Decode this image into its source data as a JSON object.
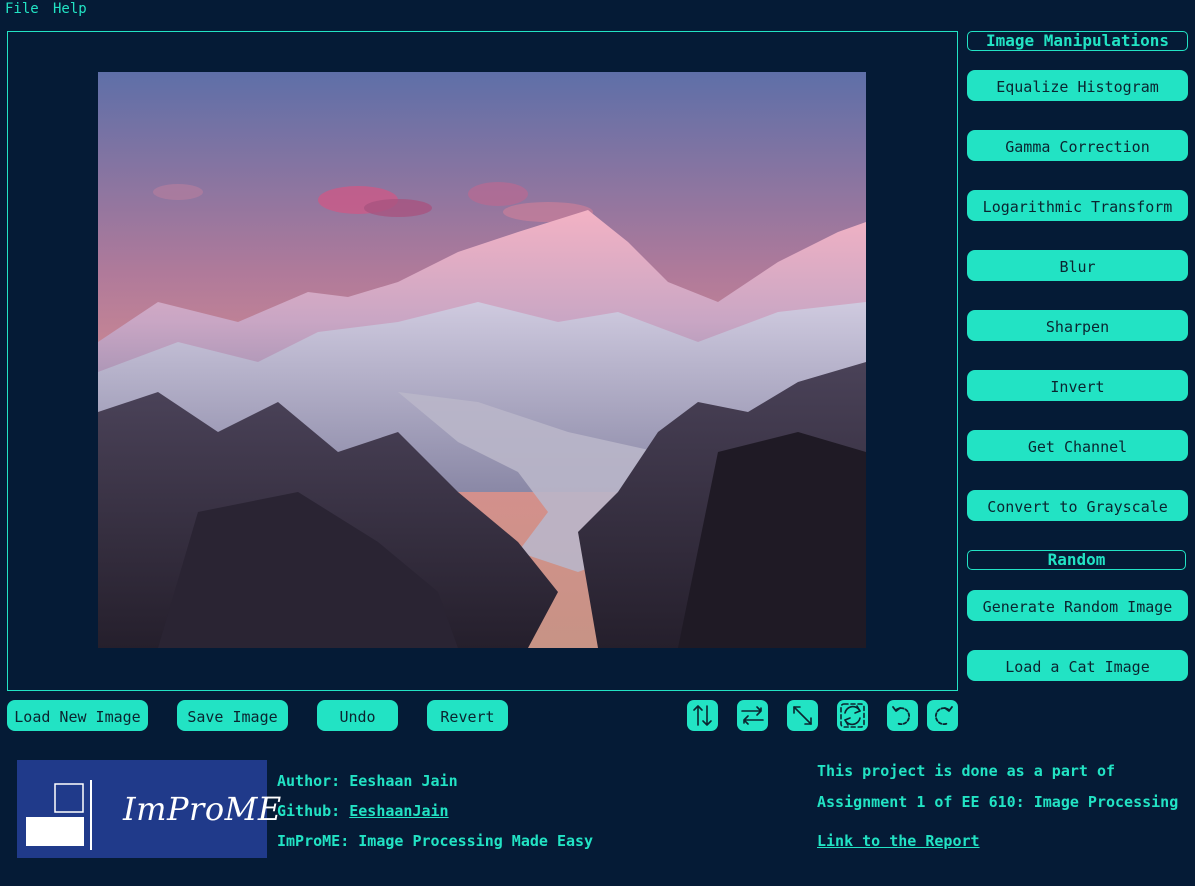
{
  "menu": {
    "file": "File",
    "help": "Help"
  },
  "sidebar": {
    "manipulations_title": "Image Manipulations",
    "manipulations": [
      "Equalize Histogram",
      "Gamma Correction",
      "Logarithmic Transform",
      "Blur",
      "Sharpen",
      "Invert",
      "Get Channel",
      "Convert to Grayscale"
    ],
    "random_title": "Random",
    "random": [
      "Generate Random Image",
      "Load a Cat Image"
    ]
  },
  "toolbar": {
    "load": "Load New Image",
    "save": "Save Image",
    "undo": "Undo",
    "revert": "Revert",
    "icons": [
      "flip-vertical-icon",
      "flip-horizontal-icon",
      "transpose-icon",
      "rotate-180-icon",
      "rotate-ccw-icon",
      "rotate-cw-icon"
    ]
  },
  "logo": {
    "text": "ImProME"
  },
  "credits": {
    "author_label": "Author: ",
    "author": "Eeshaan Jain",
    "github_label": "Github: ",
    "github": "EeshaanJain",
    "tagline": "ImProME: Image Processing Made Easy",
    "note_line1": "This project is done as a part of",
    "note_line2": "Assignment 1 of EE 610: Image Processing",
    "report_link": "Link to the Report"
  },
  "colors": {
    "background": "#051b36",
    "accent": "#22e3c4",
    "logo_bg": "#203a8a"
  }
}
